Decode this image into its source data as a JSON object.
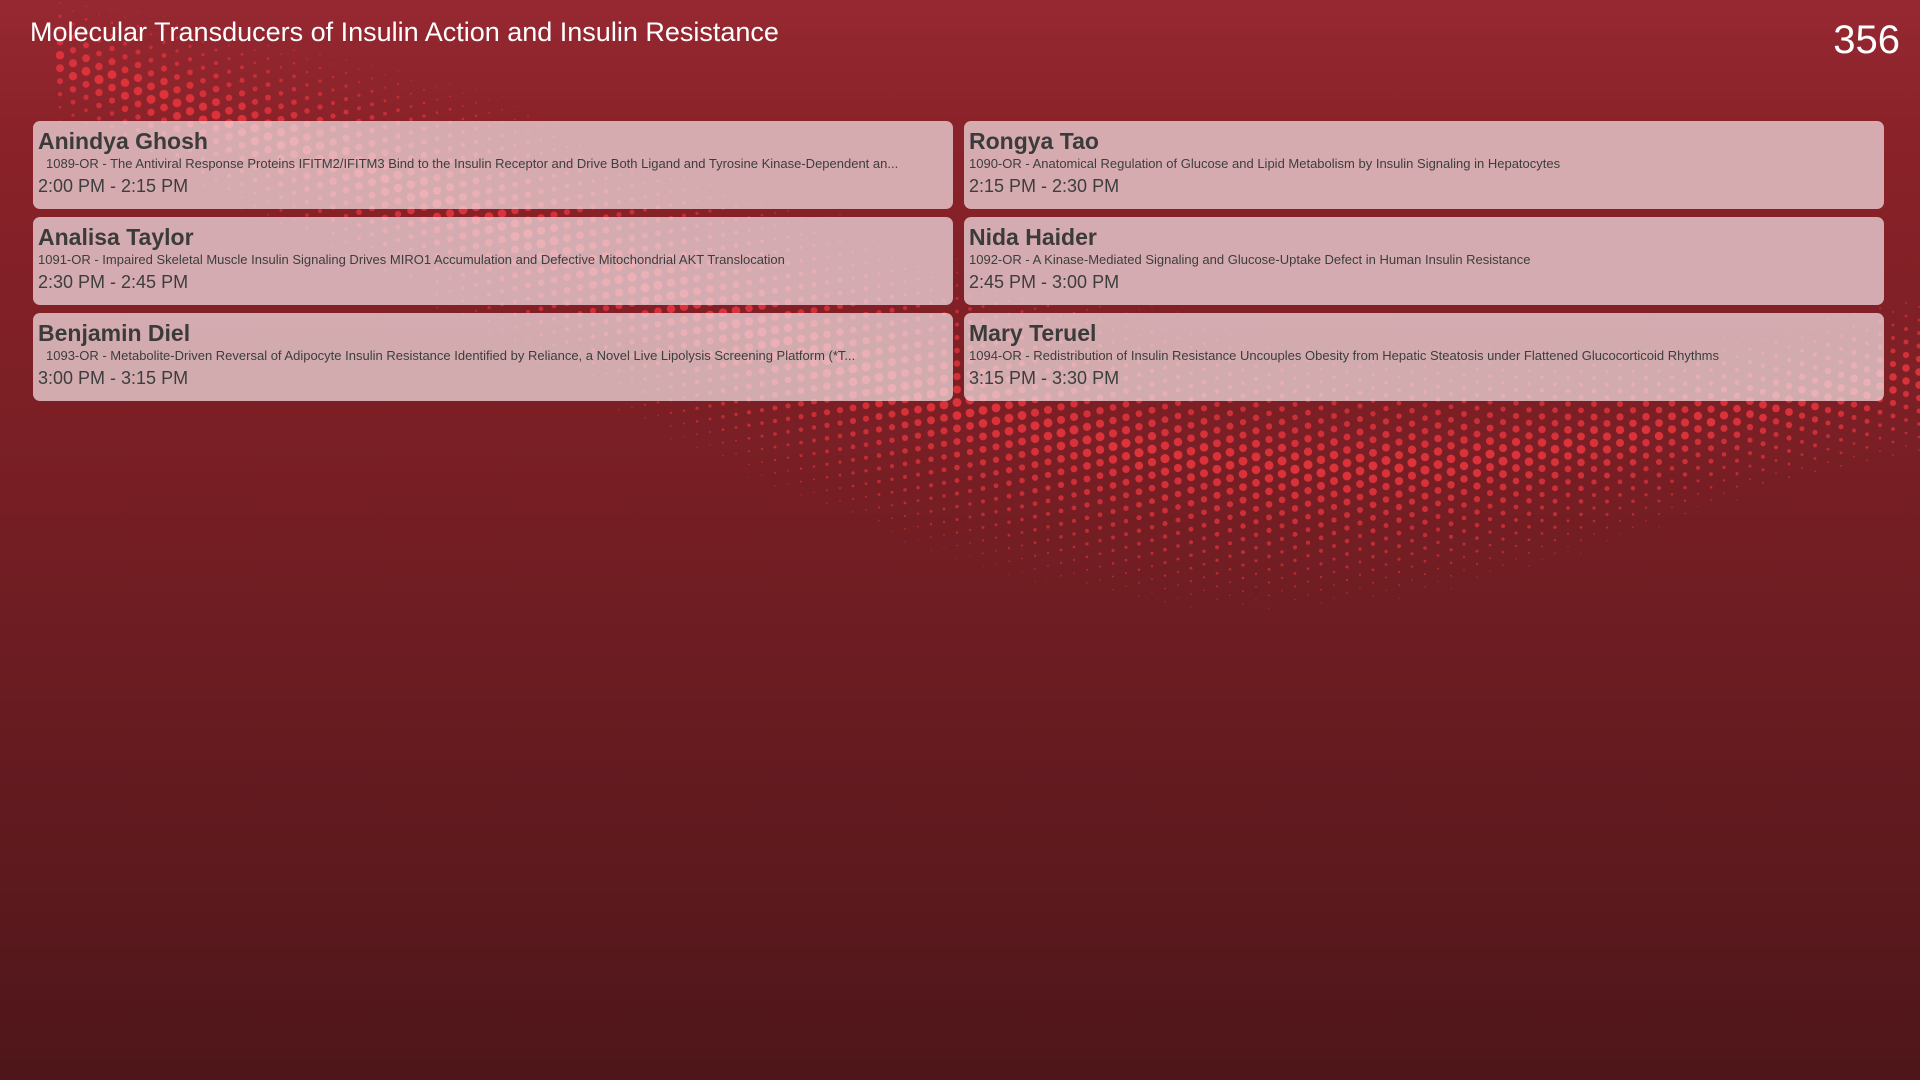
{
  "header": {
    "title": "Molecular Transducers of Insulin Action and Insulin Resistance",
    "room_number": "356"
  },
  "colors": {
    "background_top": "#962831",
    "background_bottom": "#4e161a",
    "dot_accent": "#e8353e",
    "card_fill": "#f0dce0"
  },
  "sessions": [
    {
      "speaker": "Anindya Ghosh",
      "talk": "1089-OR - The Antiviral Response Proteins IFITM2/IFITM3 Bind to the Insulin Receptor and Drive Both Ligand and Tyrosine Kinase-Dependent an...",
      "time": "2:00 PM - 2:15 PM"
    },
    {
      "speaker": "Rongya Tao",
      "talk": "1090-OR - Anatomical Regulation of Glucose and Lipid Metabolism by Insulin Signaling in Hepatocytes",
      "time": "2:15 PM - 2:30 PM"
    },
    {
      "speaker": "Analisa Taylor",
      "talk": "1091-OR - Impaired Skeletal Muscle Insulin Signaling Drives MIRO1 Accumulation and Defective Mitochondrial AKT Translocation",
      "time": "2:30 PM - 2:45 PM"
    },
    {
      "speaker": "Nida Haider",
      "talk": "1092-OR - A Kinase-Mediated Signaling and Glucose-Uptake Defect in Human Insulin Resistance",
      "time": "2:45 PM - 3:00 PM"
    },
    {
      "speaker": "Benjamin Diel",
      "talk": "1093-OR - Metabolite-Driven Reversal of Adipocyte Insulin Resistance Identified by Reliance, a Novel Live Lipolysis Screening Platform (*T...",
      "time": "3:00 PM - 3:15 PM"
    },
    {
      "speaker": "Mary Teruel",
      "talk": "1094-OR - Redistribution of Insulin Resistance Uncouples Obesity from Hepatic Steatosis under Flattened Glucocorticoid Rhythms",
      "time": "3:15 PM - 3:30 PM"
    }
  ]
}
